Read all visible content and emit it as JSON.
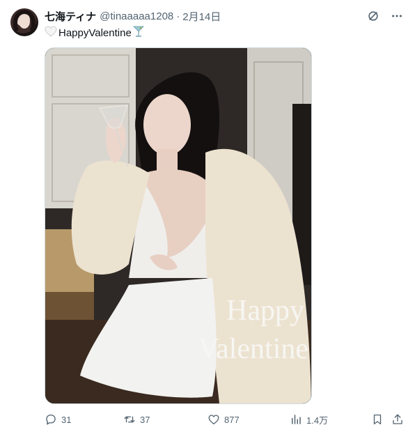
{
  "tweet": {
    "display_name": "七海ティナ",
    "handle": "@tinaaaaa1208",
    "separator": "·",
    "date": "2月14日",
    "text": "HappyValentine",
    "image_caption_line1": "Happy",
    "image_caption_line2": "Valentine"
  },
  "actions": {
    "replies": "31",
    "retweets": "37",
    "likes": "877",
    "views": "1.4万"
  },
  "icons": {
    "grok": "grok-icon",
    "more": "more-icon",
    "heart_emoji": "white-heart-icon",
    "cocktail_emoji": "cocktail-icon",
    "reply": "reply-icon",
    "retweet": "retweet-icon",
    "like": "heart-icon",
    "views": "views-icon",
    "bookmark": "bookmark-icon",
    "share": "share-icon"
  }
}
